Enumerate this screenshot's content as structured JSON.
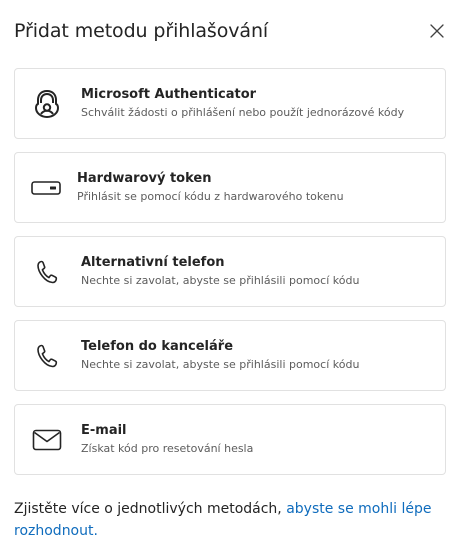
{
  "dialog": {
    "title": "Přidat metodu přihlašování",
    "close_icon": "close-icon"
  },
  "methods": [
    {
      "name": "Microsoft Authenticator",
      "description": "Schválit žádosti o přihlášení nebo použít jednorázové kódy",
      "icon": "authenticator-lock-icon"
    },
    {
      "name": "Hardwarový token",
      "description": "Přihlásit se pomocí kódu z hardwarového tokenu",
      "icon": "hardware-token-icon"
    },
    {
      "name": "Alternativní telefon",
      "description": "Nechte si zavolat, abyste se přihlásili pomocí kódu",
      "icon": "phone-icon"
    },
    {
      "name": "Telefon do kanceláře",
      "description": "Nechte si zavolat, abyste se přihlásili pomocí kódu",
      "icon": "phone-icon"
    },
    {
      "name": "E-mail",
      "description": "Získat kód pro resetování hesla",
      "icon": "mail-icon"
    }
  ],
  "footer": {
    "text": "Zjistěte více o jednotlivých metodách, ",
    "link": "abyste se mohli lépe rozhodnout."
  },
  "colors": {
    "link": "#0f6cbd",
    "border": "#e1e1e1",
    "text": "#242424",
    "secondary_text": "#5c5c5c"
  }
}
